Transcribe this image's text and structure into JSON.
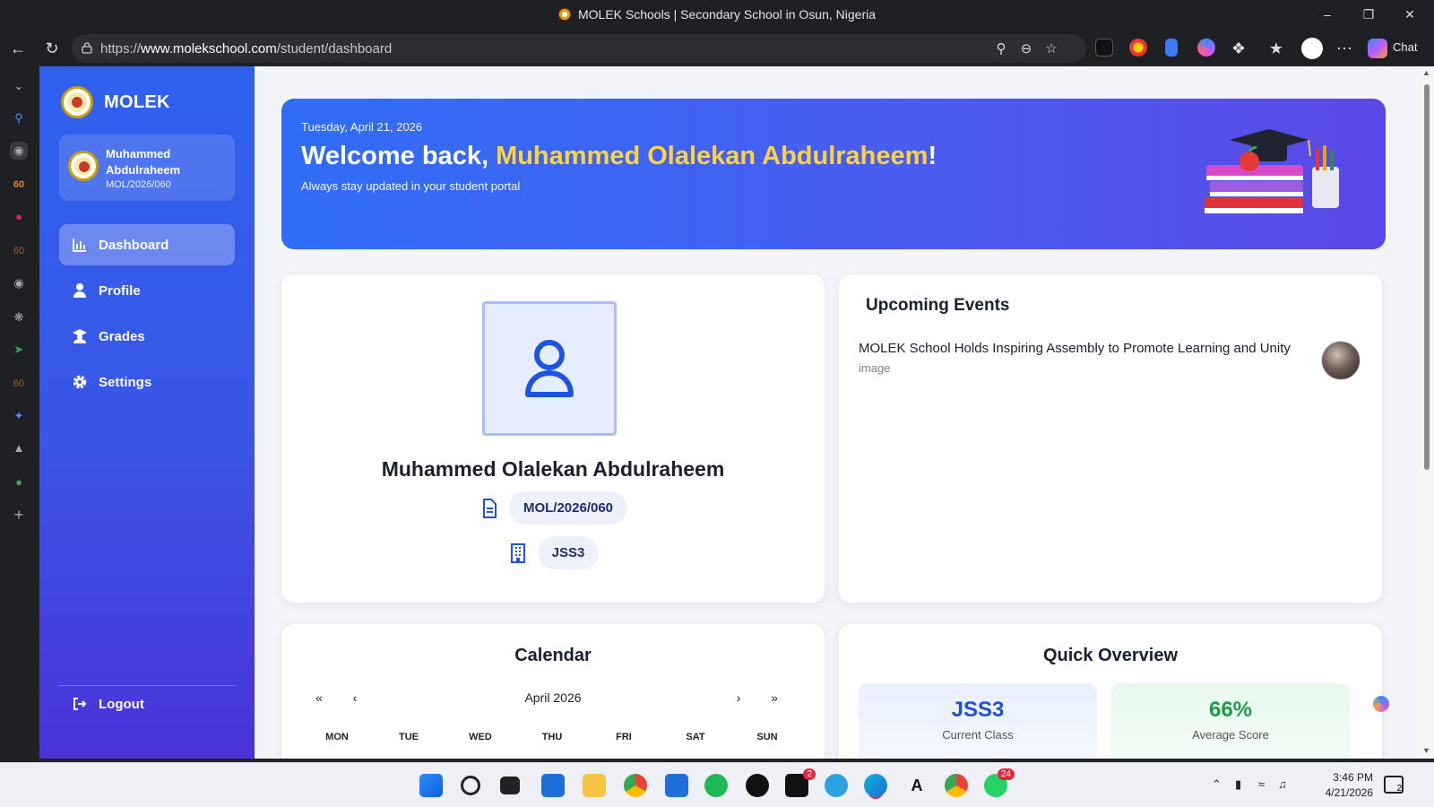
{
  "window": {
    "title": "MOLEK Schools | Secondary School in Osun, Nigeria",
    "url_prefix": "https://",
    "url_host": "www.molekschool.com",
    "url_path": "/student/dashboard",
    "chat_label": "Chat"
  },
  "sidebar": {
    "brand": "MOLEK",
    "user": {
      "name": "Muhammed Abdulraheem",
      "id": "MOL/2026/060"
    },
    "nav": [
      {
        "label": "Dashboard",
        "icon": "chart-bar-icon",
        "active": true
      },
      {
        "label": "Profile",
        "icon": "user-icon",
        "active": false
      },
      {
        "label": "Grades",
        "icon": "graduate-icon",
        "active": false
      },
      {
        "label": "Settings",
        "icon": "gear-icon",
        "active": false
      }
    ],
    "logout": "Logout"
  },
  "hero": {
    "date": "Tuesday, April 21, 2026",
    "welcome_prefix": "Welcome back, ",
    "welcome_name": "Muhammed Olalekan Abdulraheem",
    "welcome_suffix": "!",
    "subtitle": "Always stay updated in your student portal"
  },
  "profile": {
    "full_name": "Muhammed Olalekan Abdulraheem",
    "reg_number": "MOL/2026/060",
    "class": "JSS3"
  },
  "events": {
    "title": "Upcoming Events",
    "items": [
      {
        "title": "MOLEK School Holds Inspiring Assembly to Promote Learning and Unity",
        "category": "image"
      }
    ]
  },
  "calendar": {
    "title": "Calendar",
    "month": "April 2026",
    "nav": {
      "first": "«",
      "prev": "‹",
      "next": "›",
      "last": "»"
    },
    "weekdays": [
      "MON",
      "TUE",
      "WED",
      "THU",
      "FRI",
      "SAT",
      "SUN"
    ]
  },
  "overview": {
    "title": "Quick Overview",
    "stats": [
      {
        "value": "JSS3",
        "label": "Current Class",
        "color": "#1e4fd6"
      },
      {
        "value": "66%",
        "label": "Average Score",
        "color": "#1d9a4b"
      }
    ]
  },
  "taskbar": {
    "badges": {
      "x": "2",
      "whatsapp": "24"
    },
    "time": "3:46 PM",
    "date": "4/21/2026",
    "notifications": "2"
  }
}
